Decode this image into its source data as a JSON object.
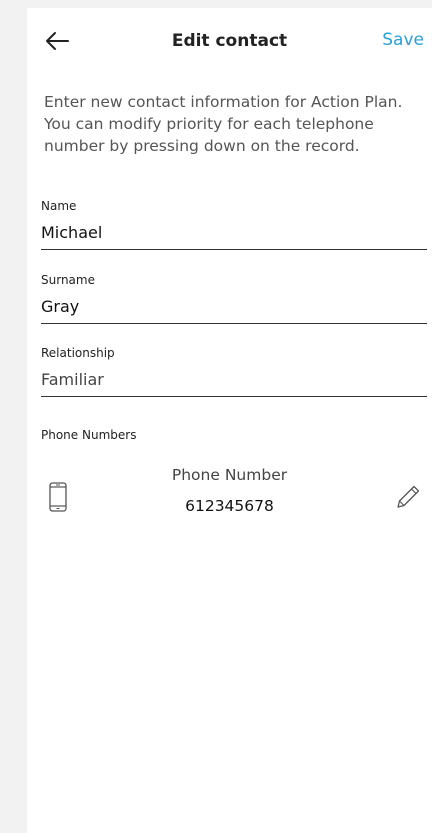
{
  "header": {
    "title": "Edit contact",
    "save_label": "Save",
    "back_icon": "arrow-left-icon",
    "accent_color": "#2a9fd8"
  },
  "intro": {
    "text": "Enter new contact information for Action Plan. You can modify priority for each telephone number by pressing down on the record."
  },
  "form": {
    "name": {
      "label": "Name",
      "value": "Michael"
    },
    "surname": {
      "label": "Surname",
      "value": "Gray"
    },
    "relationship": {
      "label": "Relationship",
      "value": "Familiar"
    }
  },
  "phones": {
    "section_label": "Phone Numbers",
    "items": [
      {
        "type_label": "Phone Number",
        "number": "612345678",
        "icon": "mobile-phone-icon",
        "edit_icon": "pencil-icon"
      }
    ]
  }
}
